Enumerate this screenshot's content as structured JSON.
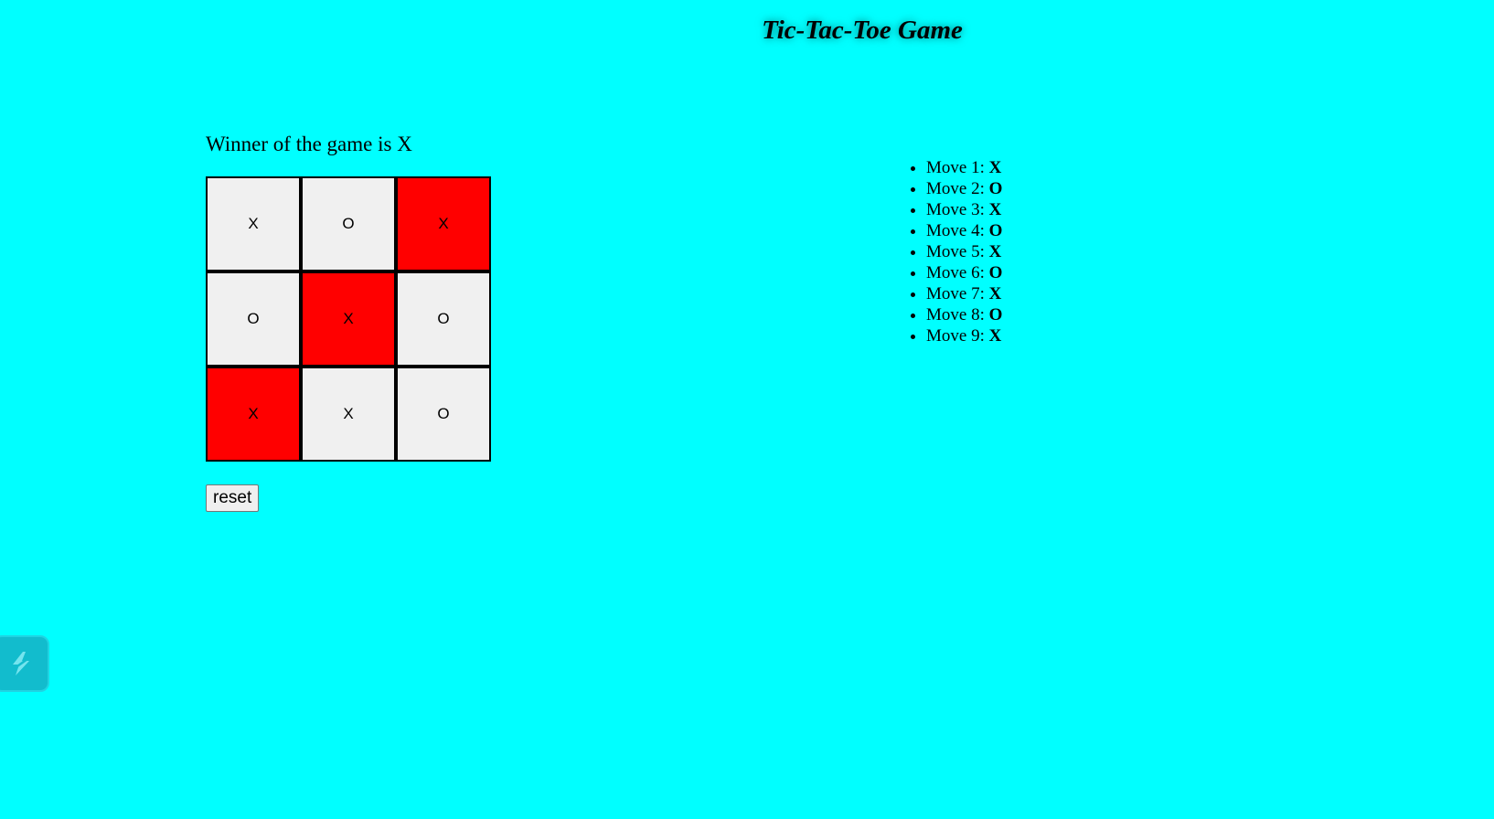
{
  "title": "Tic-Tac-Toe Game",
  "status": "Winner of the game is X",
  "board": {
    "cells": [
      {
        "mark": "X",
        "winning": false
      },
      {
        "mark": "O",
        "winning": false
      },
      {
        "mark": "X",
        "winning": true
      },
      {
        "mark": "O",
        "winning": false
      },
      {
        "mark": "X",
        "winning": true
      },
      {
        "mark": "O",
        "winning": false
      },
      {
        "mark": "X",
        "winning": true
      },
      {
        "mark": "X",
        "winning": false
      },
      {
        "mark": "O",
        "winning": false
      }
    ]
  },
  "reset_label": "reset",
  "moves": [
    {
      "label": "Move 1:",
      "player": "X"
    },
    {
      "label": "Move 2:",
      "player": "O"
    },
    {
      "label": "Move 3:",
      "player": "X"
    },
    {
      "label": "Move 4:",
      "player": "O"
    },
    {
      "label": "Move 5:",
      "player": "X"
    },
    {
      "label": "Move 6:",
      "player": "O"
    },
    {
      "label": "Move 7:",
      "player": "X"
    },
    {
      "label": "Move 8:",
      "player": "O"
    },
    {
      "label": "Move 9:",
      "player": "X"
    }
  ],
  "floating_button": {
    "icon": "lightning-bolt-icon"
  },
  "colors": {
    "background": "#00ffff",
    "cell": "#f0f0f0",
    "winning_cell": "#ff0000"
  }
}
